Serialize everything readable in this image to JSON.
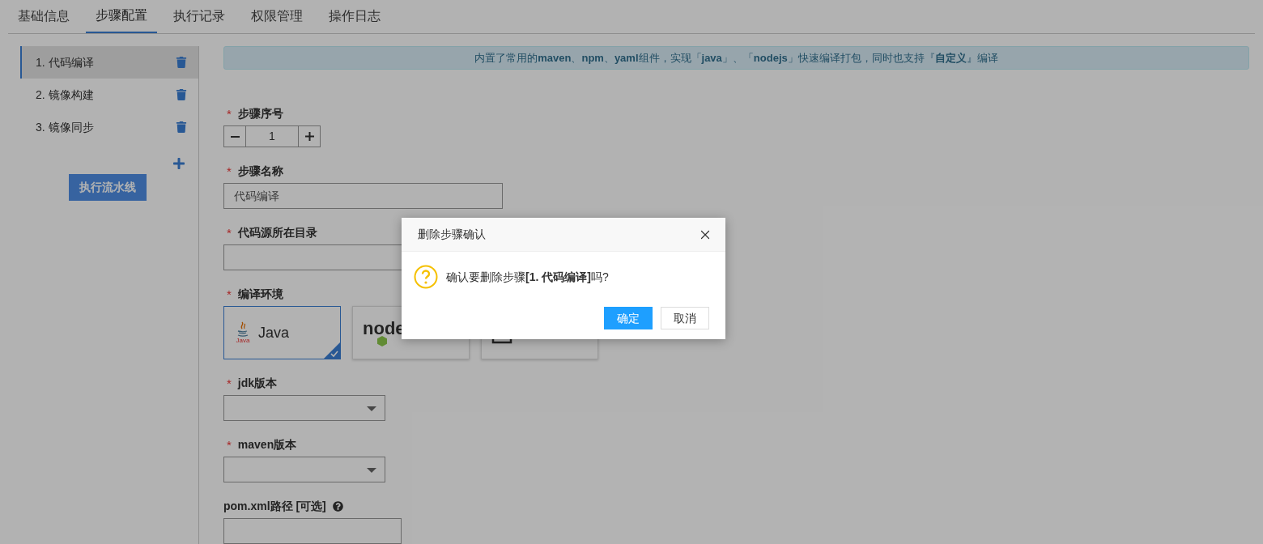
{
  "tabs": [
    {
      "label": "基础信息",
      "selected": false
    },
    {
      "label": "步骤配置",
      "selected": true
    },
    {
      "label": "执行记录",
      "selected": false
    },
    {
      "label": "权限管理",
      "selected": false
    },
    {
      "label": "操作日志",
      "selected": false
    }
  ],
  "steps": [
    {
      "label": "1. 代码编译",
      "selected": true
    },
    {
      "label": "2. 镜像构建",
      "selected": false
    },
    {
      "label": "3. 镜像同步",
      "selected": false
    }
  ],
  "run_button": "执行流水线",
  "notice": "内置了常用的**maven**、**npm**、**yaml**组件，实现「**java**」、「**nodejs**」快速编译打包，同时也支持『**自定义**』编译",
  "fields": [
    {
      "kind": "counter",
      "label": "步骤序号",
      "required_mark": "*",
      "value": "1"
    },
    {
      "kind": "text",
      "label": "步骤名称",
      "required_mark": "*",
      "value": "代码编译"
    },
    {
      "kind": "text",
      "label": "代码源所在目录",
      "required_mark": "*"
    },
    {
      "kind": "env",
      "label": "编译环境",
      "required_mark": "*",
      "options": [
        {
          "kind": "java",
          "logo_text": "Java",
          "label": "Java",
          "selected": true
        },
        {
          "kind": "node",
          "logo_text": "node",
          "selected": false
        },
        {
          "kind": "custom",
          "selected": false
        }
      ]
    },
    {
      "kind": "select",
      "label": "jdk版本",
      "required_mark": "*"
    },
    {
      "kind": "select",
      "label": "maven版本",
      "required_mark": "*"
    },
    {
      "kind": "optional",
      "label": "pom.xml路径 [可选]"
    }
  ],
  "dialog": {
    "title": "删除步骤确认",
    "message": "确认要删除步骤**[1. 代码编译]**吗?",
    "buttons": [
      {
        "label": "确定",
        "kind": "primary"
      },
      {
        "label": "取消",
        "kind": "default"
      }
    ]
  }
}
